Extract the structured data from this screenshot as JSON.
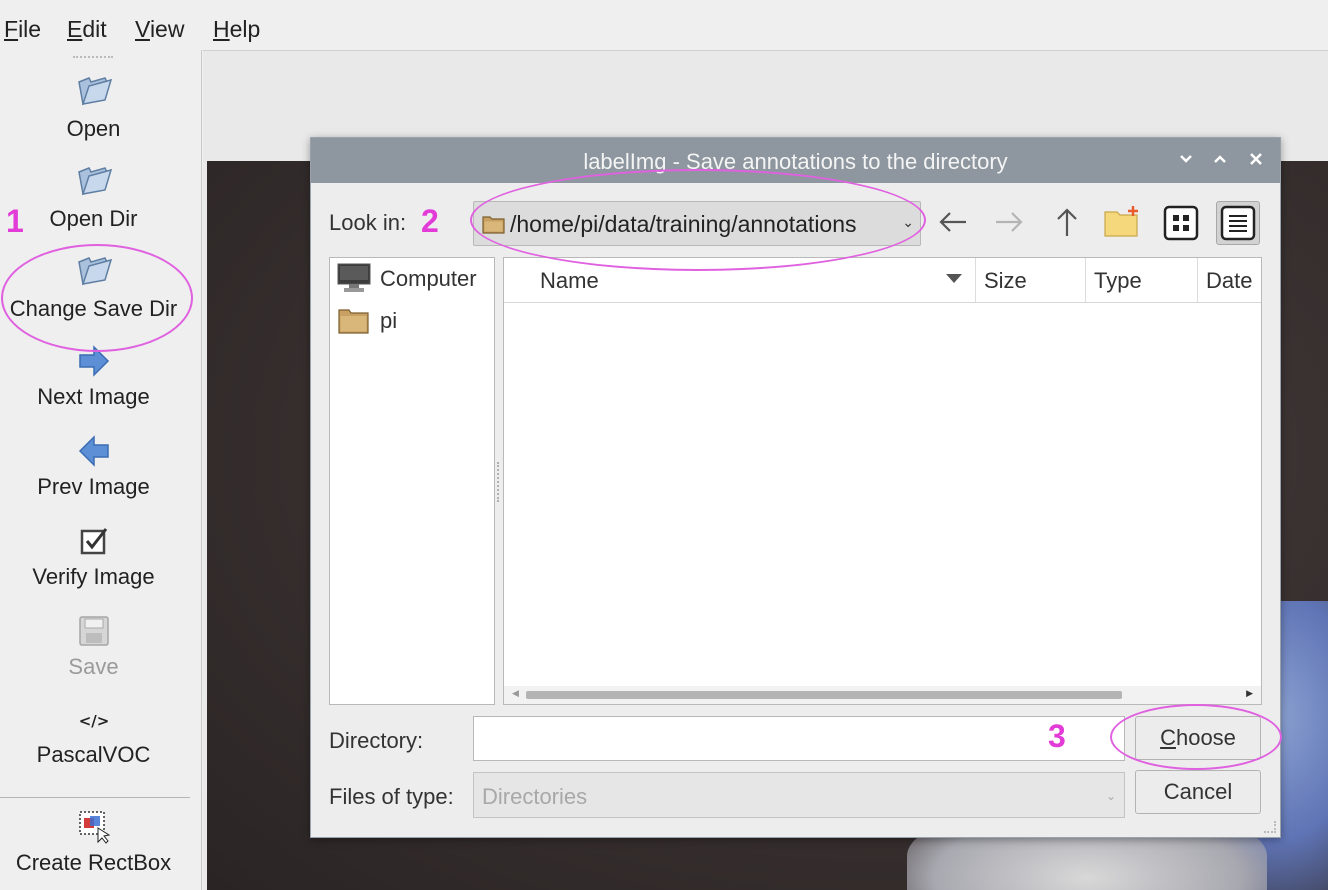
{
  "menubar": {
    "items": [
      {
        "mnemonic": "F",
        "rest": "ile"
      },
      {
        "mnemonic": "E",
        "rest": "dit"
      },
      {
        "mnemonic": "V",
        "rest": "iew"
      },
      {
        "mnemonic": "H",
        "rest": "elp"
      }
    ]
  },
  "toolbar": {
    "open": "Open",
    "open_dir": "Open Dir",
    "change_save_dir": "Change Save Dir",
    "next_image": "Next Image",
    "prev_image": "Prev Image",
    "verify_image": "Verify Image",
    "save": "Save",
    "format": "PascalVOC",
    "create_rectbox": "Create RectBox"
  },
  "dialog": {
    "title": "labelImg - Save annotations to the directory",
    "look_in_label": "Look in:",
    "look_in_path": "/home/pi/data/training/annotations",
    "sidebar": [
      "Computer",
      "pi"
    ],
    "columns": [
      "Name",
      "Size",
      "Type",
      "Date"
    ],
    "directory_label": "Directory:",
    "directory_value": "",
    "files_of_type_label": "Files of type:",
    "files_of_type_value": "Directories",
    "choose": {
      "mnemonic": "C",
      "rest": "hoose"
    },
    "cancel": "Cancel"
  },
  "annotations": [
    "1",
    "2",
    "3"
  ],
  "colors": {
    "annotation": "#e23bd8",
    "titlebar": "#8e979f",
    "folder": "#c8a063"
  },
  "icons": {
    "toolbar": [
      "folder-open-icon",
      "folder-open-icon",
      "folder-open-icon",
      "arrow-right-icon",
      "arrow-left-icon",
      "checkbox-icon",
      "save-icon",
      "code-icon",
      "rectbox-icon"
    ],
    "dialog": [
      "folder-icon",
      "back-arrow-icon",
      "forward-arrow-icon",
      "up-arrow-icon",
      "new-folder-icon",
      "icon-view-icon",
      "detail-view-icon",
      "computer-icon",
      "folder-icon"
    ]
  }
}
